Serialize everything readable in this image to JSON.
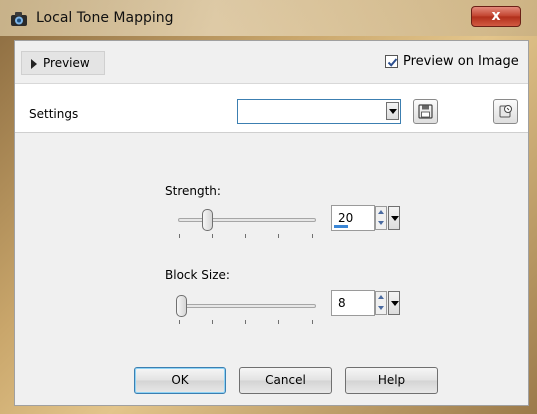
{
  "window": {
    "title": "Local Tone Mapping",
    "close_label": "x"
  },
  "preview": {
    "toggle_label": "Preview",
    "preview_on_image_label": "Preview on Image",
    "preview_on_image_checked": true
  },
  "settings": {
    "label": "Settings",
    "preset_value": ""
  },
  "strength": {
    "label": "Strength:",
    "value": "20",
    "min": 0,
    "max": 100
  },
  "block_size": {
    "label": "Block Size:",
    "value": "8",
    "min": 8,
    "max": 100
  },
  "buttons": {
    "ok": "OK",
    "cancel": "Cancel",
    "help": "Help"
  },
  "icons": {
    "app": "camera-icon",
    "save": "floppy-disk-icon",
    "preset": "preset-manager-icon"
  },
  "colors": {
    "accent": "#3a86d6",
    "close": "#c0412c"
  }
}
